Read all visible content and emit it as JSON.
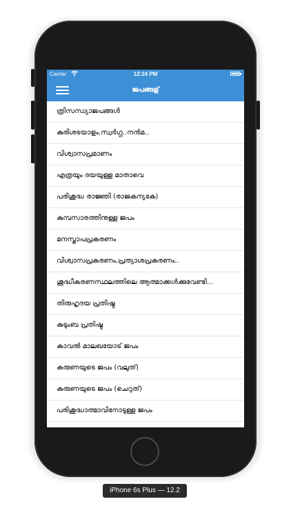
{
  "status_bar": {
    "carrier": "Carrier",
    "time": "12:24 PM"
  },
  "nav": {
    "title": "ജപങ്ങള്"
  },
  "prayers": [
    "ത്രിസന്ധ്യാജപങ്ങൾ",
    "കുരിശടയാളം,സ്വർഗ്ഗ..നൻമ..",
    "വിശ്വാസപ്രമാണം",
    "എത്രയും ദയയുള്ള മാതാവെ",
    "പരിശുദ്ധ രാജ്ഞി (രാജകന്യകേ)",
    "കുമ്പസാരത്തിനുള്ള ജപം",
    "മനസ്താപപ്രകരണം",
    "വിശ്വാസപ്രകരണം,പ്രത്യാശപ്രകരണം..",
    "ശുദ്ധീകരണസ്ഥലത്തിലെ ആത്മാക്കൾക്കുവേണ്ടി...",
    "തിരുഹൃദയ പ്രതിഷ്ഠ",
    "കുടുംബ പ്രതിഷ്ഠ",
    "കാവൽ മാലഖയോട് ജപം",
    "കരുണയുടെ ജപം (വലുത്)",
    "കരുണയുടെ ജപം (ചെറുത്)",
    "പരിശുദ്ധാത്മാവിനോടുള്ള ജപം"
  ],
  "device": {
    "label": "iPhone 6s Plus — 12.2"
  },
  "colors": {
    "accent": "#3d8fd6",
    "phone_body": "#1a1a1a",
    "divider": "#e4e4e4"
  },
  "icons": {
    "menu": "hamburger-menu-icon",
    "wifi": "wifi-icon",
    "battery": "battery-icon"
  }
}
